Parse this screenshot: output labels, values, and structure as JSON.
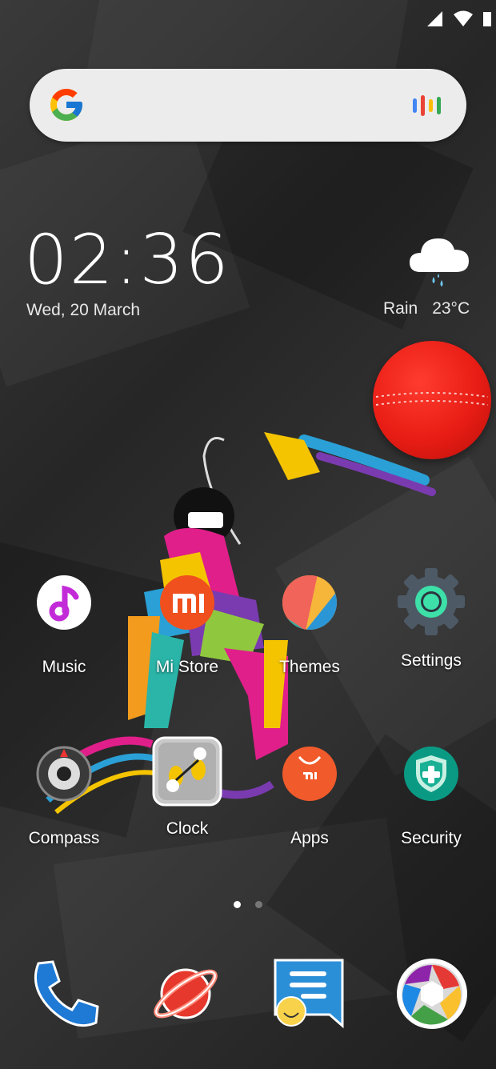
{
  "status_bar": {
    "icons": [
      "signal-icon",
      "wifi-icon",
      "battery-icon"
    ]
  },
  "search_widget": {
    "logo": "google-logo-icon",
    "voice": "voice-search-icon"
  },
  "clock_widget": {
    "time": "02:36",
    "date": "Wed, 20 March"
  },
  "weather_widget": {
    "condition": "Rain",
    "temperature": "23°C",
    "icon": "rain-cloud-icon"
  },
  "apps_row1": [
    {
      "label": "Music",
      "icon": "music-icon"
    },
    {
      "label": "Mi Store",
      "icon": "mi-store-icon"
    },
    {
      "label": "Themes",
      "icon": "themes-icon"
    },
    {
      "label": "Settings",
      "icon": "settings-gear-icon"
    }
  ],
  "apps_row2": [
    {
      "label": "Compass",
      "icon": "compass-icon"
    },
    {
      "label": "Clock",
      "icon": "clock-icon"
    },
    {
      "label": "Apps",
      "icon": "apps-bag-icon"
    },
    {
      "label": "Security",
      "icon": "security-shield-icon"
    }
  ],
  "page_indicator": {
    "pages": 2,
    "current": 1
  },
  "dock": [
    {
      "icon": "phone-icon"
    },
    {
      "icon": "browser-planet-icon"
    },
    {
      "icon": "messaging-icon"
    },
    {
      "icon": "camera-icon"
    }
  ],
  "colors": {
    "ball": "#e81d15",
    "search_bg": "#ececec",
    "security": "#0a9a84",
    "apps": "#f15a2b"
  }
}
